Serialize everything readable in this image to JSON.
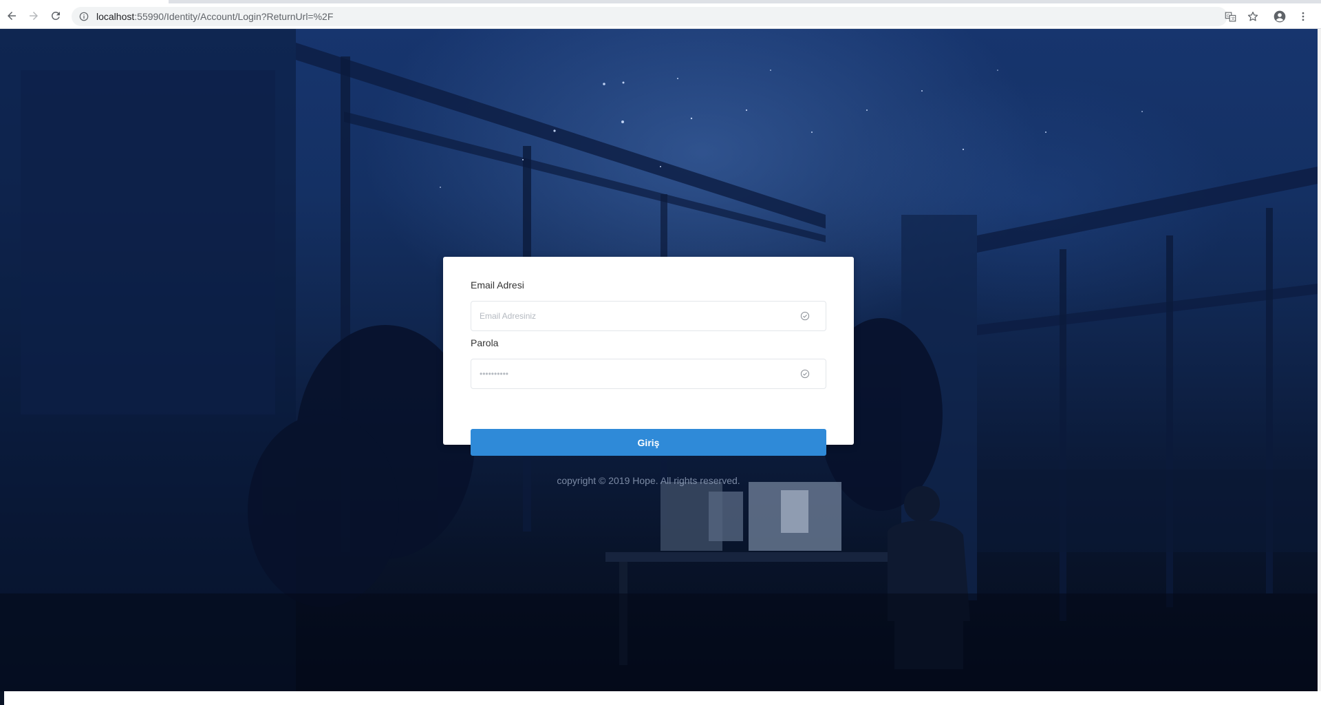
{
  "browser": {
    "url_host": "localhost",
    "url_rest": ":55990/Identity/Account/Login?ReturnUrl=%2F",
    "back_icon": "arrow-left-icon",
    "forward_icon": "arrow-right-icon",
    "reload_icon": "reload-icon",
    "info_icon": "info-icon",
    "translate_icon": "translate-icon",
    "bookmark_icon": "star-icon",
    "profile_icon": "account-circle-icon",
    "menu_icon": "more-vertical-icon"
  },
  "login": {
    "email_label": "Email Adresi",
    "email_placeholder": "Email Adresiniz",
    "password_label": "Parola",
    "password_placeholder": "••••••••••",
    "submit_label": "Giriş"
  },
  "footer": {
    "copyright": "copyright © 2019 Hope. All rights reserved."
  },
  "colors": {
    "button": "#2f8ad8",
    "background_top": "#17356e",
    "background_bottom": "#050c1c",
    "card": "#ffffff"
  }
}
